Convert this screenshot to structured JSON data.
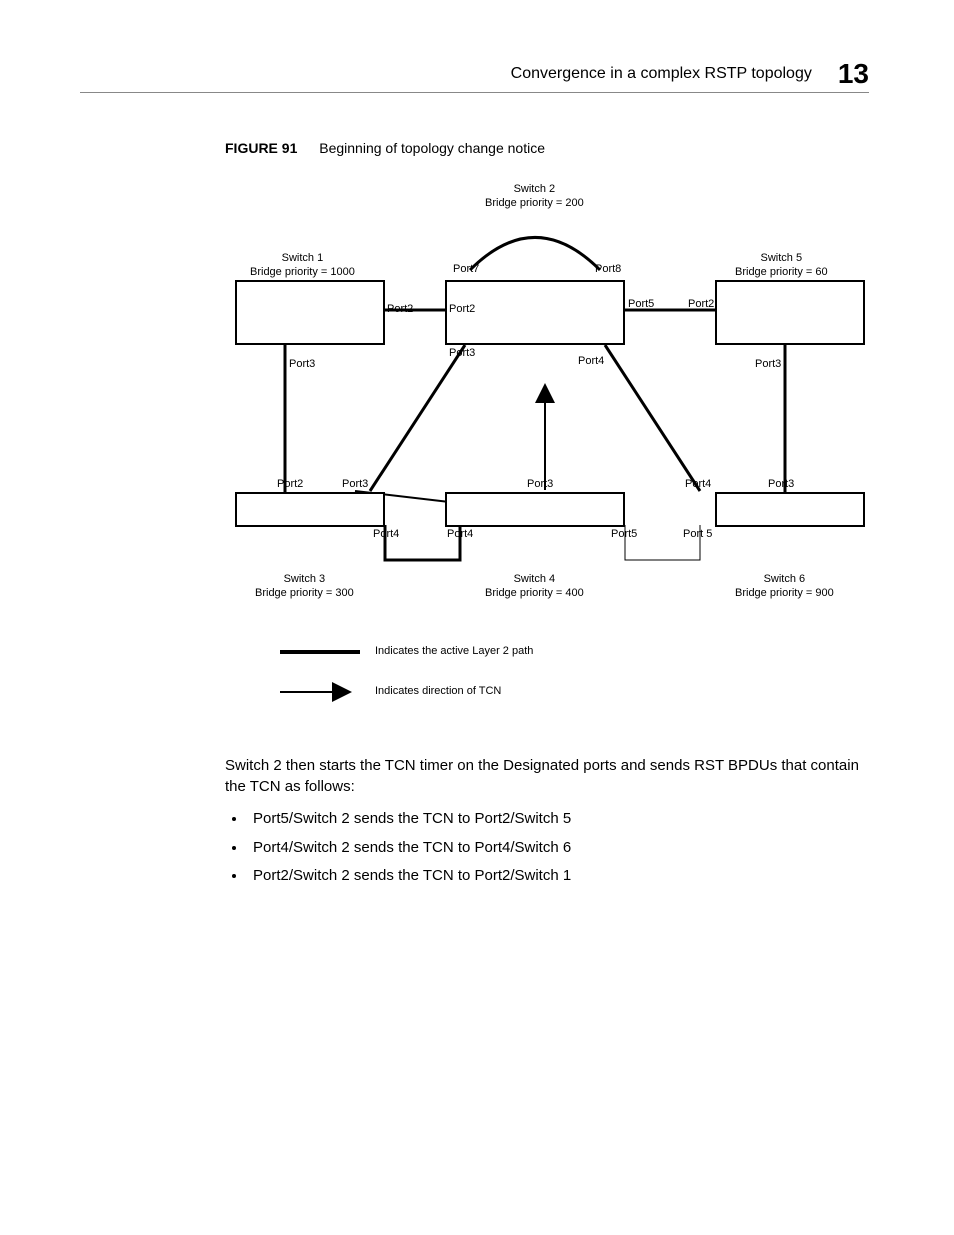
{
  "header": {
    "title": "Convergence in a complex RSTP topology",
    "chapter": "13"
  },
  "figure": {
    "label": "FIGURE 91",
    "caption": "Beginning of topology change notice",
    "switches": {
      "s1": {
        "name": "Switch 1",
        "priority": "Bridge priority = 1000"
      },
      "s2": {
        "name": "Switch 2",
        "priority": "Bridge priority = 200"
      },
      "s3": {
        "name": "Switch 3",
        "priority": "Bridge priority = 300"
      },
      "s4": {
        "name": "Switch 4",
        "priority": "Bridge priority = 400"
      },
      "s5": {
        "name": "Switch 5",
        "priority": "Bridge priority = 60"
      },
      "s6": {
        "name": "Switch 6",
        "priority": "Bridge priority = 900"
      }
    },
    "ports": {
      "s2_p7": "Port7",
      "s2_p8": "Port8",
      "s2_p2": "Port2",
      "s2_p2b": "Port2",
      "s2_p3": "Port3",
      "s2_p4": "Port4",
      "s2_p5": "Port5",
      "s5_p2": "Port2",
      "s1_p3": "Port3",
      "s5_p3": "Port3",
      "s3_p2": "Port2",
      "s3_p3": "Port3",
      "s4_p3": "Port3",
      "s6_p4": "Port4",
      "s6_p3": "Port3",
      "s3_p4": "Port4",
      "s4_p4l": "Port4",
      "s4_p5": "Port5",
      "s6_p5": "Port 5"
    },
    "legend": {
      "active": "Indicates the active Layer 2 path",
      "tcn": "Indicates direction of TCN"
    }
  },
  "body": {
    "para": "Switch 2 then starts the TCN timer on the Designated ports and sends RST BPDUs that contain the TCN as follows:",
    "bullets": [
      "Port5/Switch 2 sends the TCN to Port2/Switch 5",
      "Port4/Switch 2 sends the TCN to Port4/Switch 6",
      "Port2/Switch 2 sends the TCN to Port2/Switch 1"
    ]
  }
}
